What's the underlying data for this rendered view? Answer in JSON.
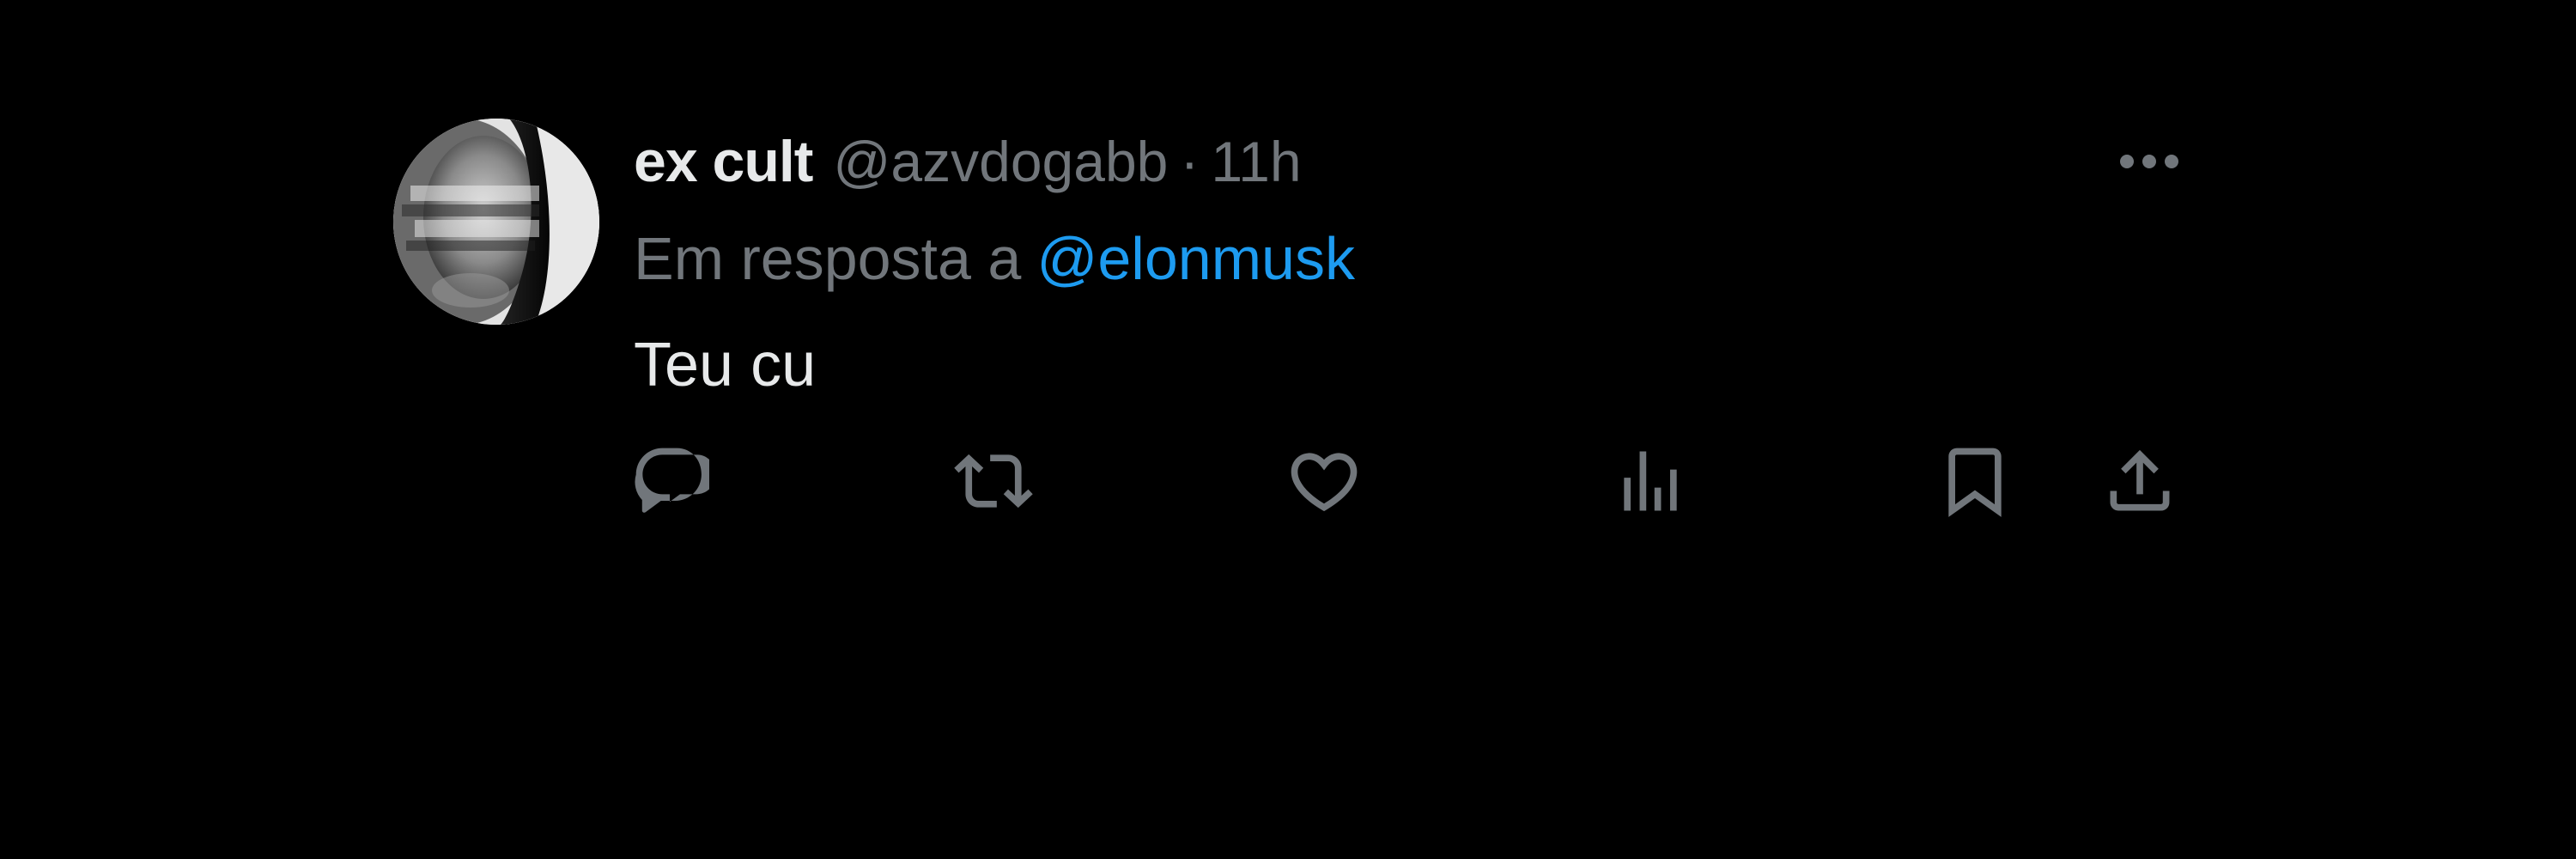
{
  "tweet": {
    "display_name": "ex cult",
    "handle": "@azvdogabb",
    "separator": "·",
    "time": "11h",
    "reply_prefix": "Em resposta a",
    "reply_to": "@elonmusk",
    "text": "Teu cu",
    "more_icon": "more-horizontal-icon"
  },
  "actions": [
    {
      "name": "reply",
      "icon": "reply-icon"
    },
    {
      "name": "repost",
      "icon": "repost-icon"
    },
    {
      "name": "like",
      "icon": "heart-icon"
    },
    {
      "name": "views",
      "icon": "views-icon"
    },
    {
      "name": "bookmark",
      "icon": "bookmark-icon"
    },
    {
      "name": "share",
      "icon": "share-icon"
    }
  ],
  "colors": {
    "background": "#000000",
    "primary_text": "#e7e9ea",
    "secondary_text": "#71767b",
    "accent": "#1d9bf0"
  }
}
